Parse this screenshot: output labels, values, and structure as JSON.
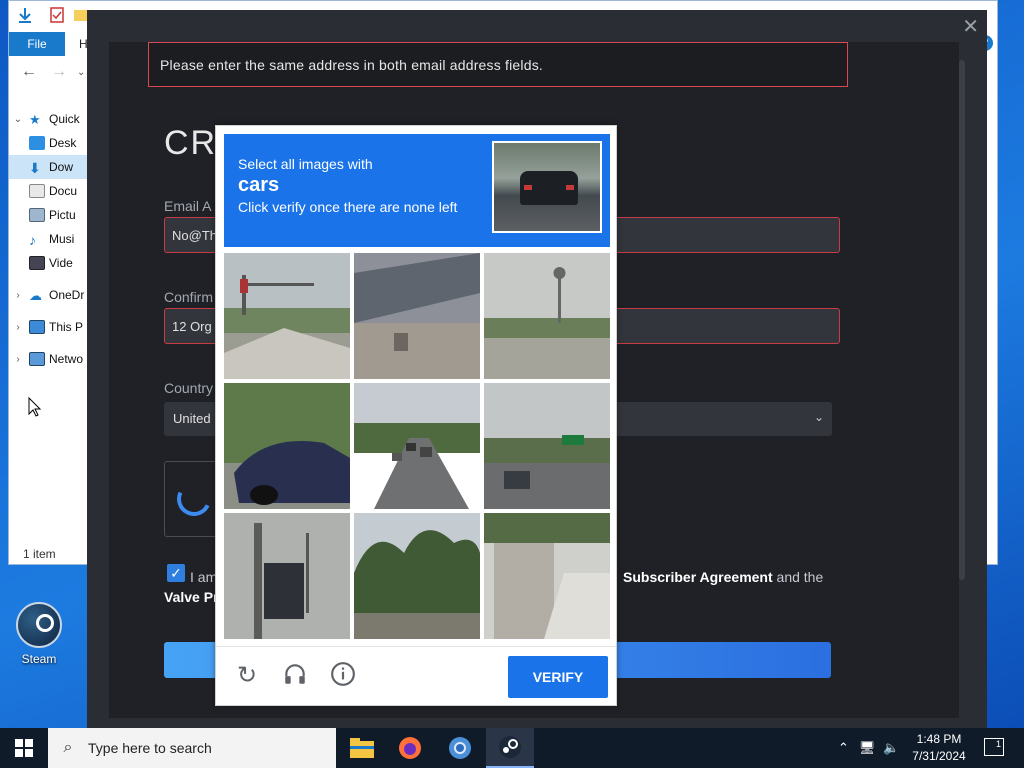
{
  "explorer": {
    "file_tab": "File",
    "home_tab": "H",
    "tree": [
      {
        "label": "Quick",
        "selected": false
      },
      {
        "label": "Desk",
        "selected": false
      },
      {
        "label": "Dow",
        "selected": true
      },
      {
        "label": "Docu",
        "selected": false
      },
      {
        "label": "Pictu",
        "selected": false
      },
      {
        "label": "Musi",
        "selected": false
      },
      {
        "label": "Vide",
        "selected": false
      },
      {
        "label": "OneDr",
        "selected": false
      },
      {
        "label": "This P",
        "selected": false
      },
      {
        "label": "Netwo",
        "selected": false
      }
    ],
    "status": "1 item"
  },
  "steam_dialog": {
    "close_glyph": "✕",
    "error_message": "Please enter the same address in both email address fields.",
    "heading_partial": "CR",
    "email_label": "Email A",
    "email_value": "No@Th",
    "confirm_label": "Confirm",
    "confirm_value": "12 Org",
    "country_label": "Country",
    "country_value": "United",
    "agree_prefix": "I am",
    "agree_link": "Subscriber Agreement",
    "agree_suffix": " and the",
    "agree_line2": "Valve Pr",
    "agree_checked": true
  },
  "captcha": {
    "instruction_line1": "Select all images with",
    "target": "cars",
    "instruction_line3": "Click verify once there are none left",
    "tiles": [
      "traffic-light-intersection",
      "building-wall",
      "roadside-water-tower",
      "blue-car-closeup",
      "multi-lane-road-cars",
      "road-with-car-and-sign",
      "traffic-signal-pole",
      "palm-trees",
      "stone-steps"
    ],
    "reload_icon": "reload-icon",
    "audio_icon": "headphones-icon",
    "info_icon": "info-icon",
    "verify_label": "VERIFY"
  },
  "desktop": {
    "steam_icon_label": "Steam"
  },
  "taskbar": {
    "search_placeholder": "Type here to search",
    "time": "1:48 PM",
    "date": "7/31/2024",
    "notification_count": "1"
  }
}
